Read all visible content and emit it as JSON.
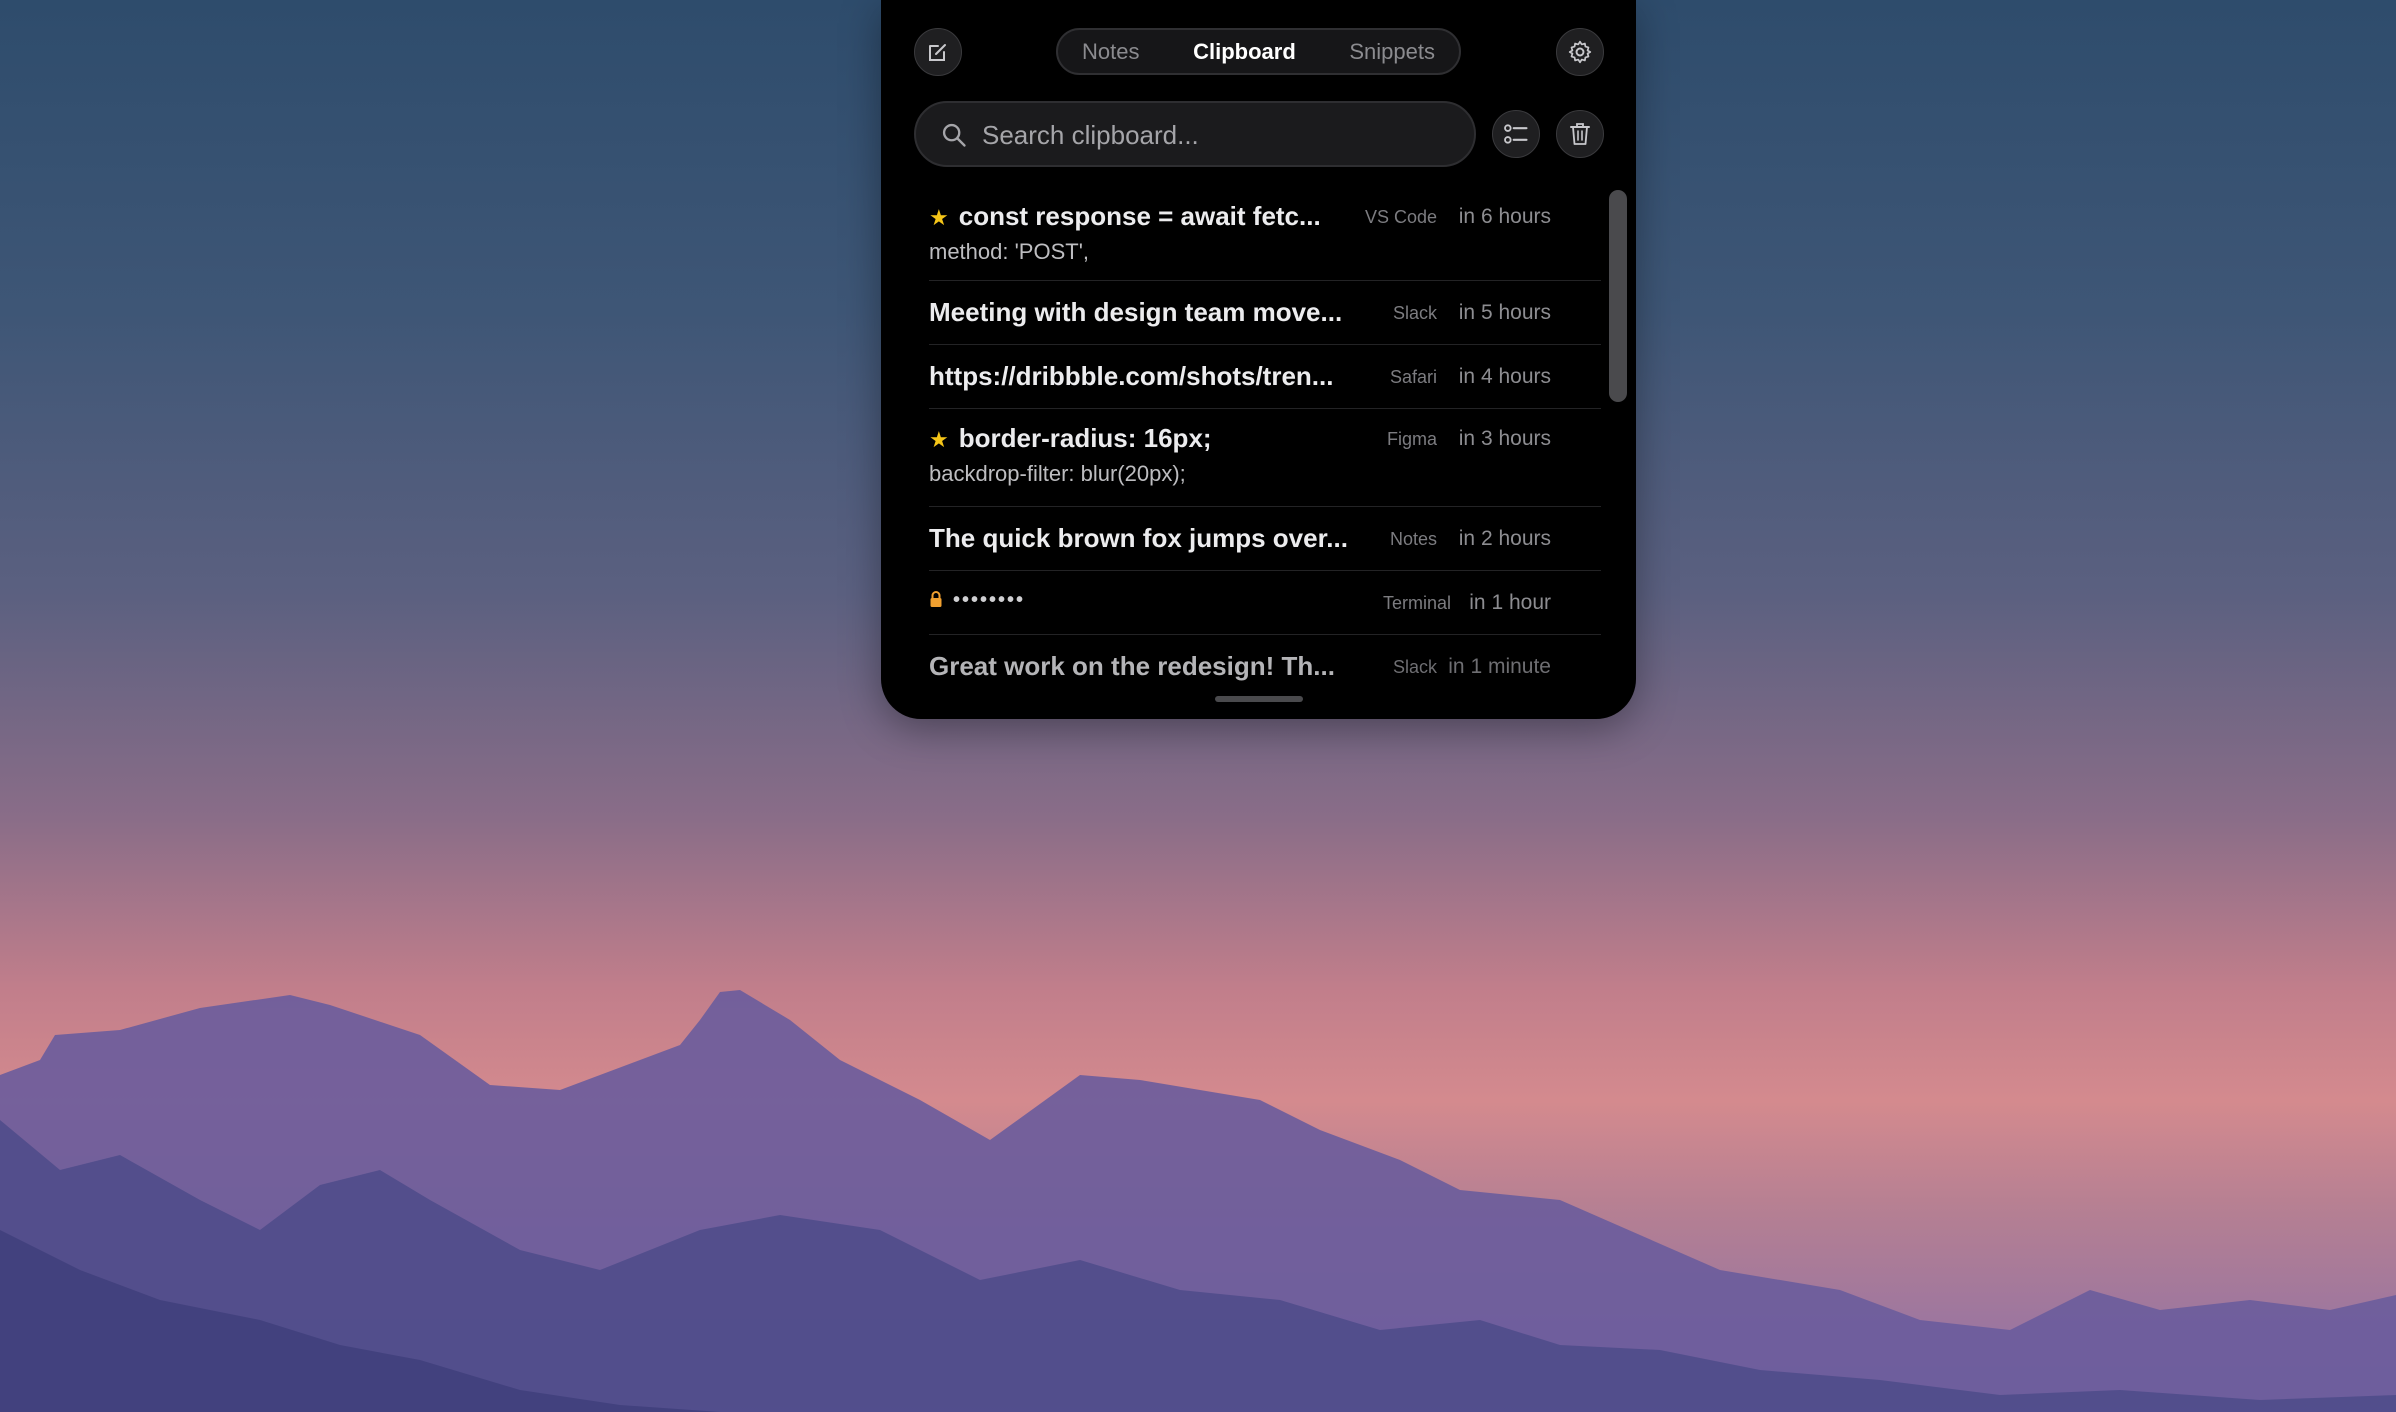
{
  "toolbar": {
    "compose_icon": "compose-icon",
    "settings_icon": "gear-icon",
    "tabs": [
      {
        "label": "Notes",
        "active": false
      },
      {
        "label": "Clipboard",
        "active": true
      },
      {
        "label": "Snippets",
        "active": false
      }
    ]
  },
  "search": {
    "placeholder": "Search clipboard...",
    "value": ""
  },
  "actions": {
    "list_icon": "checklist-icon",
    "trash_icon": "trash-icon"
  },
  "clips": [
    {
      "starred": true,
      "title": "const response = await fetc...",
      "subtitle": "method: 'POST',",
      "app": "VS Code",
      "time": "in 6 hours"
    },
    {
      "starred": false,
      "title": "Meeting with design team move...",
      "subtitle": "",
      "app": "Slack",
      "time": "in 5 hours"
    },
    {
      "starred": false,
      "title": "https://dribbble.com/shots/tren...",
      "subtitle": "",
      "app": "Safari",
      "time": "in 4 hours"
    },
    {
      "starred": true,
      "title": "border-radius: 16px;",
      "subtitle": "backdrop-filter: blur(20px);",
      "app": "Figma",
      "time": "in 3 hours"
    },
    {
      "starred": false,
      "title": "The quick brown fox jumps over...",
      "subtitle": "",
      "app": "Notes",
      "time": "in 2 hours"
    },
    {
      "starred": false,
      "locked": true,
      "title": "••••••••",
      "subtitle": "",
      "app": "Terminal",
      "time": "in 1 hour"
    },
    {
      "starred": false,
      "title": "Great work on the redesign! Th...",
      "subtitle": "",
      "app": "Slack",
      "time": "in 1 minute"
    }
  ],
  "colors": {
    "panel": "#000000",
    "star": "#f5c518",
    "lock": "#f0a030"
  }
}
